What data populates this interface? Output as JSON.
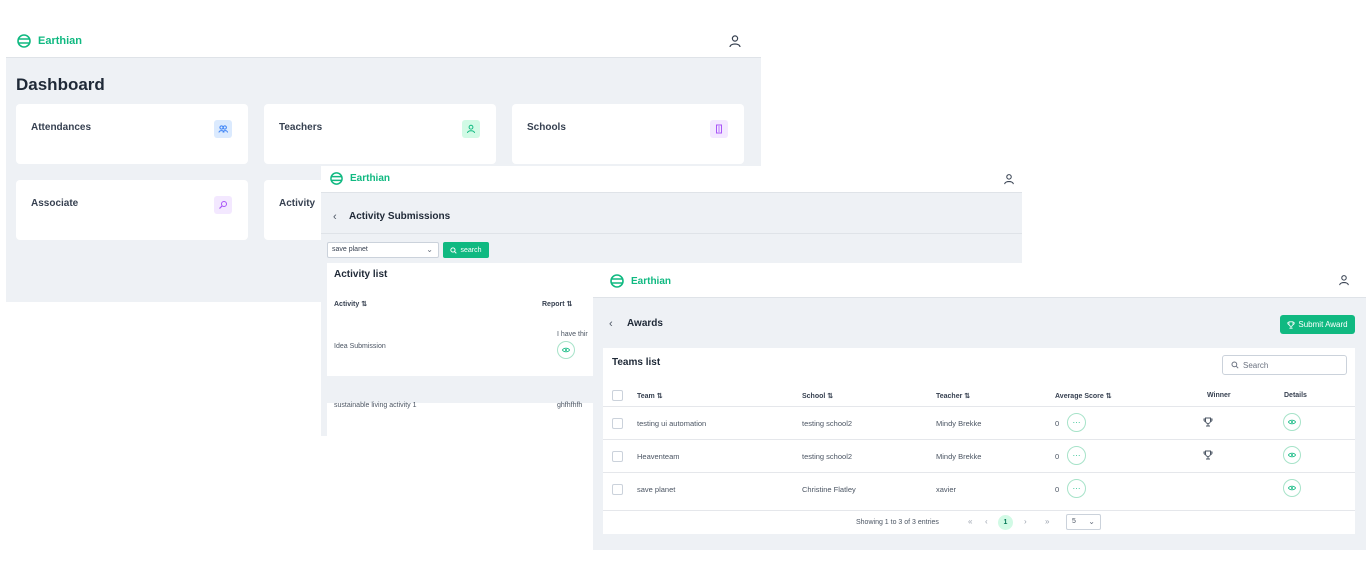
{
  "brand": {
    "name": "Earthian",
    "color": "#10b981"
  },
  "dashboard": {
    "title": "Dashboard",
    "cards": [
      {
        "label": "Attendances",
        "icon": "users-icon",
        "icon_bg": "#dbeafe",
        "icon_color": "#3b82f6"
      },
      {
        "label": "Teachers",
        "icon": "user-icon",
        "icon_bg": "#d1fae5",
        "icon_color": "#10b981"
      },
      {
        "label": "Schools",
        "icon": "building-icon",
        "icon_bg": "#f3e8ff",
        "icon_color": "#a855f7"
      },
      {
        "label": "Associate",
        "icon": "search-icon",
        "icon_bg": "#f3e8ff",
        "icon_color": "#a855f7"
      },
      {
        "label": "Activity",
        "icon": "",
        "icon_bg": "",
        "icon_color": ""
      }
    ]
  },
  "activity": {
    "title": "Activity Submissions",
    "select_value": "save planet",
    "search_label": "search",
    "list_title": "Activity list",
    "columns": [
      "Activity",
      "Report"
    ],
    "rows": [
      {
        "activity": "Idea Submission",
        "report": "I have thir"
      },
      {
        "activity": "sustainable living activity 1",
        "report": "ghfhfhfh"
      }
    ]
  },
  "awards": {
    "title": "Awards",
    "submit_label": "Submit Award",
    "list_title": "Teams list",
    "search_placeholder": "Search",
    "columns": [
      "Team",
      "School",
      "Teacher",
      "Average Score",
      "Winner",
      "Details"
    ],
    "rows": [
      {
        "team": "testing ui automation",
        "school": "testing school2",
        "teacher": "Mindy Brekke",
        "score": "0",
        "winner": true
      },
      {
        "team": "Heaventeam",
        "school": "testing school2",
        "teacher": "Mindy Brekke",
        "score": "0",
        "winner": true
      },
      {
        "team": "save planet",
        "school": "Christine Flatley",
        "teacher": "xavier",
        "score": "0",
        "winner": false
      }
    ],
    "pagination": {
      "info": "Showing 1 to 3 of 3 entries",
      "current_page": "1",
      "rows_per_page": "5",
      "first": "«",
      "prev": "‹",
      "next": "›",
      "last": "»"
    }
  }
}
